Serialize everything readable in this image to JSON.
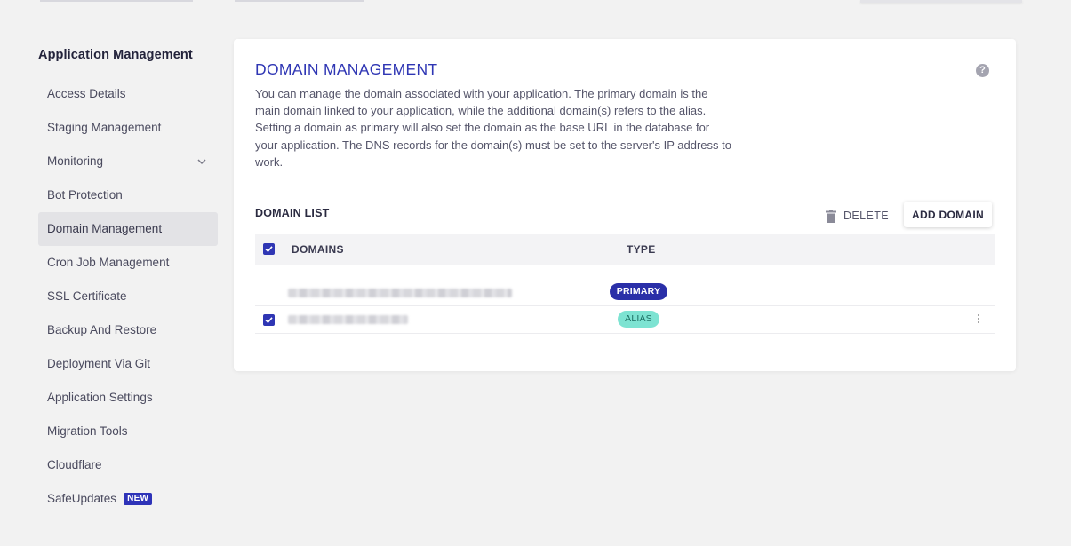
{
  "sidebar": {
    "title": "Application Management",
    "items": [
      {
        "label": "Access Details"
      },
      {
        "label": "Staging Management"
      },
      {
        "label": "Monitoring"
      },
      {
        "label": "Bot Protection"
      },
      {
        "label": "Domain Management"
      },
      {
        "label": "Cron Job Management"
      },
      {
        "label": "SSL Certificate"
      },
      {
        "label": "Backup And Restore"
      },
      {
        "label": "Deployment Via Git"
      },
      {
        "label": "Application Settings"
      },
      {
        "label": "Migration Tools"
      },
      {
        "label": "Cloudflare"
      },
      {
        "label": "SafeUpdates",
        "badge": "NEW"
      }
    ],
    "active_item": "Domain Management"
  },
  "main": {
    "title": "DOMAIN MANAGEMENT",
    "help_icon": "?",
    "description": "You can manage the domain associated with your application. The primary domain is the main domain linked to your application, while the additional domain(s) refers to the alias. Setting a domain as primary will also set the domain as the base URL in the database for your application. The DNS records for the domain(s) must be set to the server's IP address to work.",
    "list_heading": "DOMAIN LIST",
    "delete_label": "DELETE",
    "add_domain_label": "ADD DOMAIN",
    "table": {
      "columns": [
        "DOMAINS",
        "TYPE"
      ],
      "rows": [
        {
          "domain": "",
          "type": "PRIMARY",
          "checked": false
        },
        {
          "domain": "",
          "type": "ALIAS",
          "checked": true
        }
      ]
    }
  },
  "colors": {
    "accent": "#2f36b4",
    "primary_badge": "#2a2fa8",
    "alias_badge": "#7de3d2",
    "background": "#f2f2f2"
  }
}
